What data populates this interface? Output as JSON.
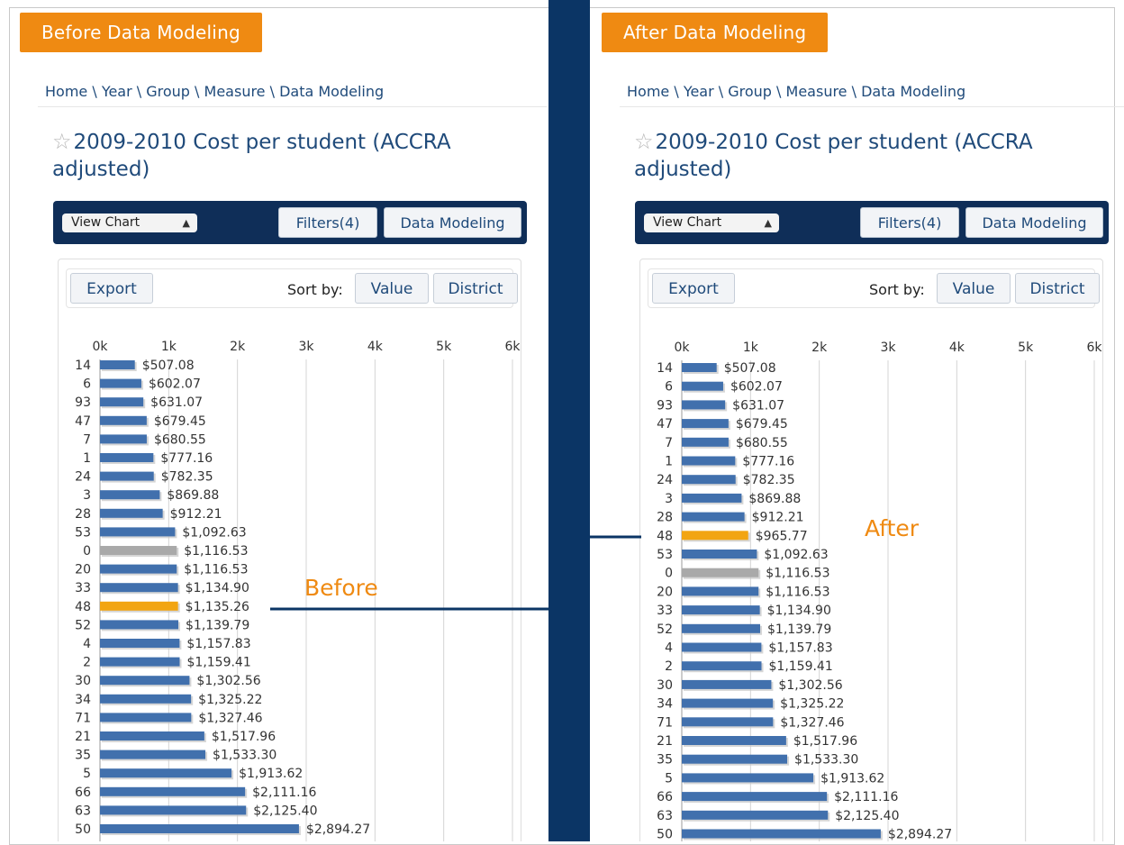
{
  "colors": {
    "brand_orange": "#ef8a12",
    "navy": "#0b3565",
    "bar_blue": "#4170ad",
    "bar_gray": "#a9a9a9",
    "highlight": "#f2a512"
  },
  "icons": {
    "star": "star-icon",
    "select_arrow": "updown-arrows-icon"
  },
  "panels": {
    "before": {
      "tag": "Before Data Modeling",
      "breadcrumb": "Home \\ Year \\ Group \\ Measure \\ Data Modeling",
      "title_line1": "2009-2010 Cost per student (ACCRA",
      "title_line2": "adjusted)",
      "view_select": "View Chart",
      "filters_button": "Filters(4)",
      "modeling_button": "Data Modeling",
      "export_button": "Export",
      "sort_label": "Sort by:",
      "sort_value_button": "Value",
      "sort_district_button": "District",
      "annotation": "Before"
    },
    "after": {
      "tag": "After Data Modeling",
      "breadcrumb": "Home \\ Year \\ Group \\ Measure \\ Data Modeling",
      "title_line1": "2009-2010 Cost per student (ACCRA",
      "title_line2": "adjusted)",
      "view_select": "View Chart",
      "filters_button": "Filters(4)",
      "modeling_button": "Data Modeling",
      "export_button": "Export",
      "sort_label": "Sort by:",
      "sort_value_button": "Value",
      "sort_district_button": "District",
      "annotation": "After"
    }
  },
  "chart_data": [
    {
      "type": "bar",
      "orientation": "horizontal",
      "ticks": [
        "0k",
        "1k",
        "2k",
        "3k",
        "4k",
        "5k",
        "6k"
      ],
      "xlim": [
        0,
        6000
      ],
      "grid": true,
      "highlight_category": "48",
      "gray_category": "0",
      "categories": [
        "14",
        "6",
        "93",
        "47",
        "7",
        "1",
        "24",
        "3",
        "28",
        "53",
        "0",
        "20",
        "33",
        "48",
        "52",
        "4",
        "2",
        "30",
        "34",
        "71",
        "21",
        "35",
        "5",
        "66",
        "63",
        "50"
      ],
      "values": [
        507.08,
        602.07,
        631.07,
        679.45,
        680.55,
        777.16,
        782.35,
        869.88,
        912.21,
        1092.63,
        1116.53,
        1116.53,
        1134.9,
        1135.26,
        1139.79,
        1157.83,
        1159.41,
        1302.56,
        1325.22,
        1327.46,
        1517.96,
        1533.3,
        1913.62,
        2111.16,
        2125.4,
        2894.27
      ],
      "labels": [
        "$507.08",
        "$602.07",
        "$631.07",
        "$679.45",
        "$680.55",
        "$777.16",
        "$782.35",
        "$869.88",
        "$912.21",
        "$1,092.63",
        "$1,116.53",
        "$1,116.53",
        "$1,134.90",
        "$1,135.26",
        "$1,139.79",
        "$1,157.83",
        "$1,159.41",
        "$1,302.56",
        "$1,325.22",
        "$1,327.46",
        "$1,517.96",
        "$1,533.30",
        "$1,913.62",
        "$2,111.16",
        "$2,125.40",
        "$2,894.27"
      ]
    },
    {
      "type": "bar",
      "orientation": "horizontal",
      "ticks": [
        "0k",
        "1k",
        "2k",
        "3k",
        "4k",
        "5k",
        "6k"
      ],
      "xlim": [
        0,
        6000
      ],
      "grid": true,
      "highlight_category": "48",
      "gray_category": "0",
      "categories": [
        "14",
        "6",
        "93",
        "47",
        "7",
        "1",
        "24",
        "3",
        "28",
        "48",
        "53",
        "0",
        "20",
        "33",
        "52",
        "4",
        "2",
        "30",
        "34",
        "71",
        "21",
        "35",
        "5",
        "66",
        "63",
        "50"
      ],
      "values": [
        507.08,
        602.07,
        631.07,
        679.45,
        680.55,
        777.16,
        782.35,
        869.88,
        912.21,
        965.77,
        1092.63,
        1116.53,
        1116.53,
        1134.9,
        1139.79,
        1157.83,
        1159.41,
        1302.56,
        1325.22,
        1327.46,
        1517.96,
        1533.3,
        1913.62,
        2111.16,
        2125.4,
        2894.27
      ],
      "labels": [
        "$507.08",
        "$602.07",
        "$631.07",
        "$679.45",
        "$680.55",
        "$777.16",
        "$782.35",
        "$869.88",
        "$912.21",
        "$965.77",
        "$1,092.63",
        "$1,116.53",
        "$1,116.53",
        "$1,134.90",
        "$1,139.79",
        "$1,157.83",
        "$1,159.41",
        "$1,302.56",
        "$1,325.22",
        "$1,327.46",
        "$1,517.96",
        "$1,533.30",
        "$1,913.62",
        "$2,111.16",
        "$2,125.40",
        "$2,894.27"
      ]
    }
  ]
}
